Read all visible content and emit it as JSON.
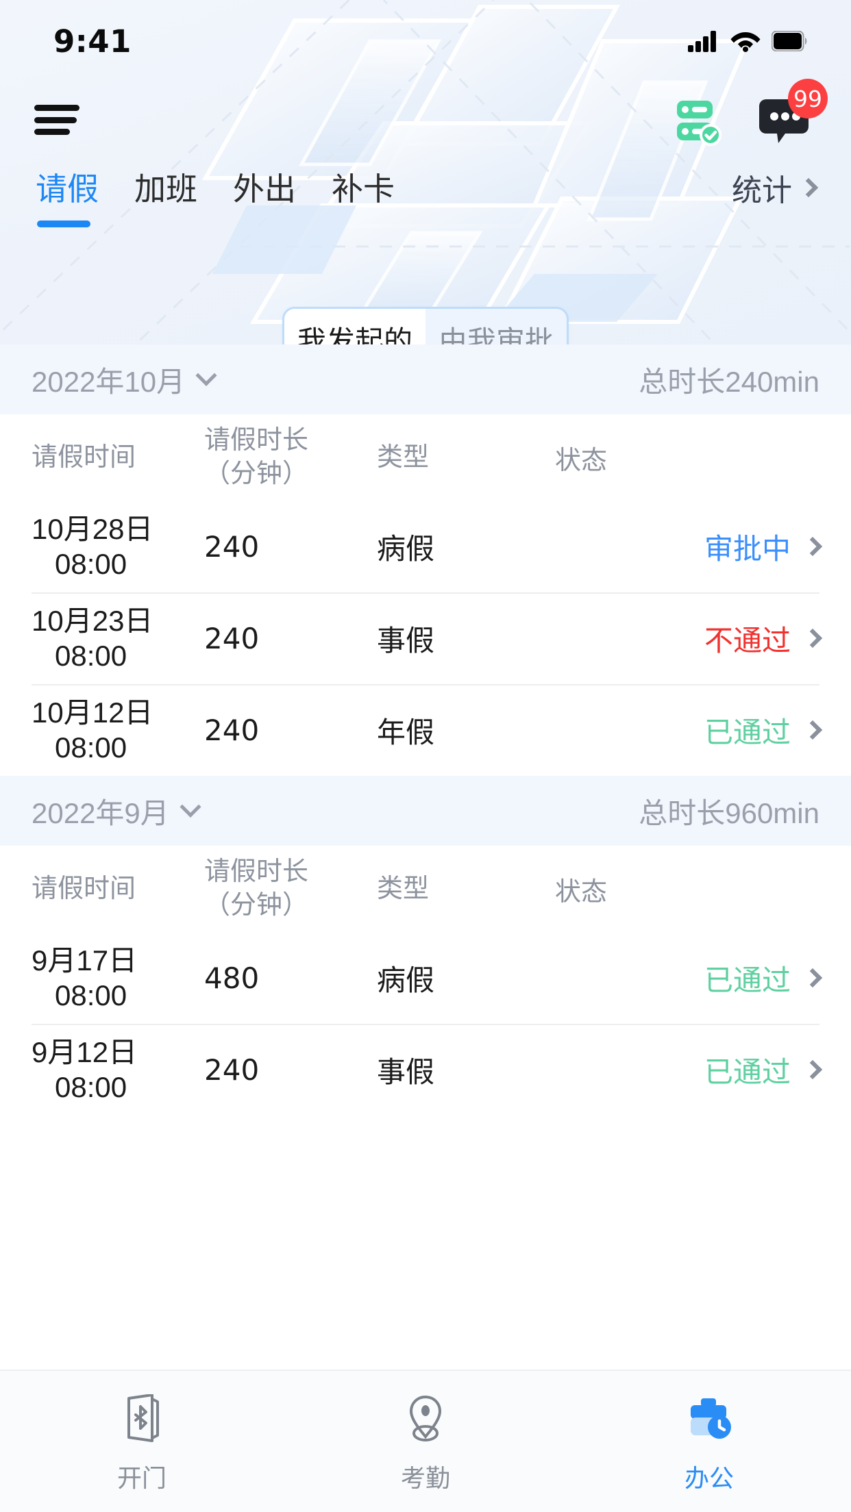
{
  "status_bar": {
    "time": "9:41",
    "signal_icon": "cellular-signal-icon",
    "wifi_icon": "wifi-icon",
    "battery_icon": "battery-icon"
  },
  "nav": {
    "menu_icon": "hamburger-menu-icon",
    "tasks_icon": "tasks-approval-icon",
    "chat_icon": "chat-bubble-icon",
    "chat_badge": "99"
  },
  "tabs": {
    "items": [
      {
        "label": "请假",
        "active": true
      },
      {
        "label": "加班",
        "active": false
      },
      {
        "label": "外出",
        "active": false
      },
      {
        "label": "补卡",
        "active": false
      }
    ],
    "stat_label": "统计",
    "stat_icon": "chevron-right-icon"
  },
  "segmented": {
    "options": [
      {
        "label": "我发起的",
        "active": true
      },
      {
        "label": "由我审批",
        "active": false
      }
    ]
  },
  "columns": {
    "date": "请假时间",
    "duration_line1": "请假时长",
    "duration_line2": "（分钟）",
    "type": "类型",
    "status": "状态"
  },
  "groups": [
    {
      "month": "2022年10月",
      "caret_icon": "chevron-down-icon",
      "total": "总时长240min",
      "rows": [
        {
          "date_day": "10月28日",
          "date_time": "08:00",
          "duration": "240",
          "type": "病假",
          "status": "审批中",
          "status_kind": "pending",
          "chevron_icon": "chevron-right-icon"
        },
        {
          "date_day": "10月23日",
          "date_time": "08:00",
          "duration": "240",
          "type": "事假",
          "status": "不通过",
          "status_kind": "rejected",
          "chevron_icon": "chevron-right-icon"
        },
        {
          "date_day": "10月12日",
          "date_time": "08:00",
          "duration": "240",
          "type": "年假",
          "status": "已通过",
          "status_kind": "approved",
          "chevron_icon": "chevron-right-icon"
        }
      ]
    },
    {
      "month": "2022年9月",
      "caret_icon": "chevron-down-icon",
      "total": "总时长960min",
      "rows": [
        {
          "date_day": "9月17日",
          "date_time": "08:00",
          "duration": "480",
          "type": "病假",
          "status": "已通过",
          "status_kind": "approved",
          "chevron_icon": "chevron-right-icon"
        },
        {
          "date_day": "9月12日",
          "date_time": "08:00",
          "duration": "240",
          "type": "事假",
          "status": "已通过",
          "status_kind": "approved",
          "chevron_icon": "chevron-right-icon"
        }
      ]
    }
  ],
  "tabbar": {
    "items": [
      {
        "label": "开门",
        "icon": "bluetooth-door-icon",
        "active": false
      },
      {
        "label": "考勤",
        "icon": "location-pin-icon",
        "active": false
      },
      {
        "label": "办公",
        "icon": "briefcase-clock-icon",
        "active": true
      }
    ]
  },
  "colors": {
    "accent_blue": "#1d87f4",
    "status_pending": "#3b8ffb",
    "status_rejected": "#f0322f",
    "status_approved": "#5fd0a0",
    "badge_red": "#fc3f41",
    "tasks_green": "#4cd7a0",
    "hero_bg": "#eef3fb"
  }
}
